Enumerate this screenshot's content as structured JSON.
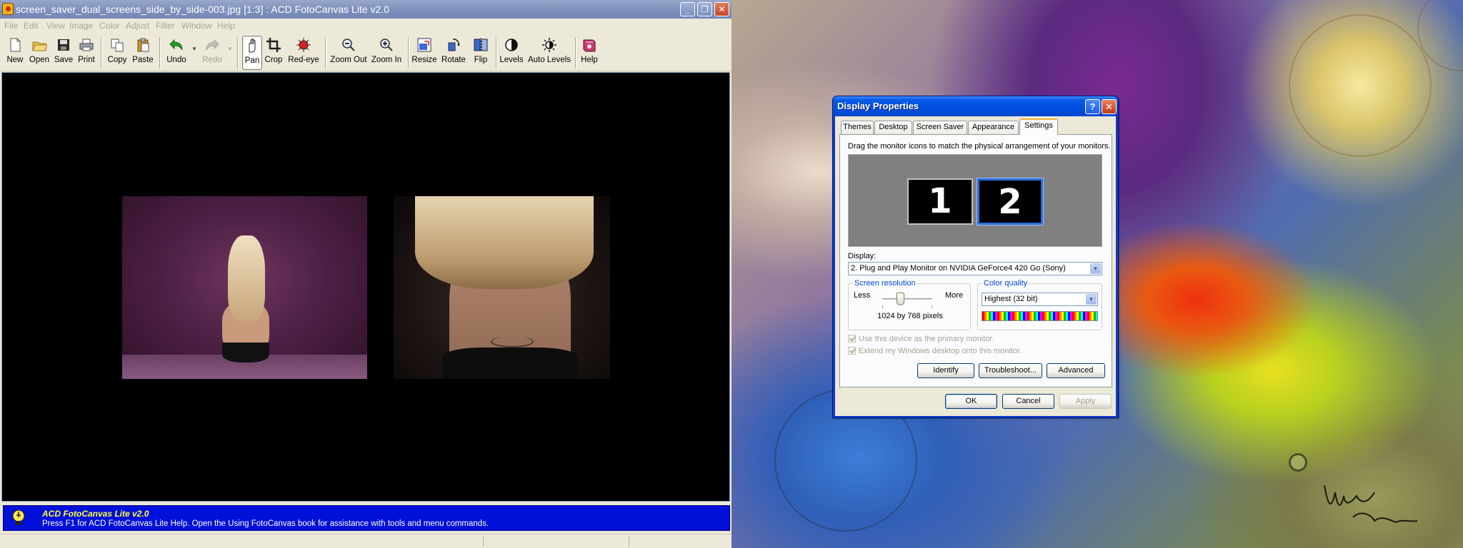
{
  "foto_canvas": {
    "title": "screen_saver_dual_screens_side_by_side-003.jpg [1:3] : ACD FotoCanvas Lite v2.0",
    "window_controls": {
      "minimize": "_",
      "maximize": "❐",
      "close": "✕"
    },
    "menu": [
      "File",
      "Edit",
      "View",
      "Image",
      "Color",
      "Adjust",
      "Filter",
      "Window",
      "Help"
    ],
    "toolbar": {
      "new": "New",
      "open": "Open",
      "save": "Save",
      "print": "Print",
      "copy": "Copy",
      "paste": "Paste",
      "undo": "Undo",
      "redo": "Redo",
      "pan": "Pan",
      "crop": "Crop",
      "red_eye": "Red-eye",
      "zoom_out": "Zoom Out",
      "zoom_in": "Zoom In",
      "resize": "Resize",
      "rotate": "Rotate",
      "flip": "Flip",
      "levels": "Levels",
      "auto_levels": "Auto Levels",
      "help": "Help"
    },
    "status": {
      "title": "ACD FotoCanvas Lite v2.0",
      "text": "Press F1 for ACD FotoCanvas Lite Help.  Open the Using FotoCanvas book for assistance with tools and menu commands."
    }
  },
  "display_properties": {
    "title": "Display Properties",
    "help_button": "?",
    "close_button": "✕",
    "tabs": [
      "Themes",
      "Desktop",
      "Screen Saver",
      "Appearance",
      "Settings"
    ],
    "selected_tab": "Settings",
    "drag_hint": "Drag the monitor icons to match the physical arrangement of your monitors.",
    "monitors": [
      "1",
      "2"
    ],
    "display_label": "Display:",
    "display_value": "2. Plug and Play Monitor on NVIDIA GeForce4 420 Go (Sony)",
    "screen_resolution": {
      "legend": "Screen resolution",
      "less": "Less",
      "more": "More",
      "value": "1024 by 768 pixels"
    },
    "color_quality": {
      "legend": "Color quality",
      "value": "Highest (32 bit)"
    },
    "checkboxes": {
      "primary": "Use this device as the primary monitor.",
      "extend": "Extend my Windows desktop onto this monitor."
    },
    "buttons": {
      "identify": "Identify",
      "troubleshoot": "Troubleshoot...",
      "advanced": "Advanced",
      "ok": "OK",
      "cancel": "Cancel",
      "apply": "Apply"
    }
  },
  "colors": {
    "status_bar": "#0010d8",
    "status_title": "#ffff40",
    "xp_title_blue": "#0050e0",
    "group_legend": "#0046d5"
  }
}
